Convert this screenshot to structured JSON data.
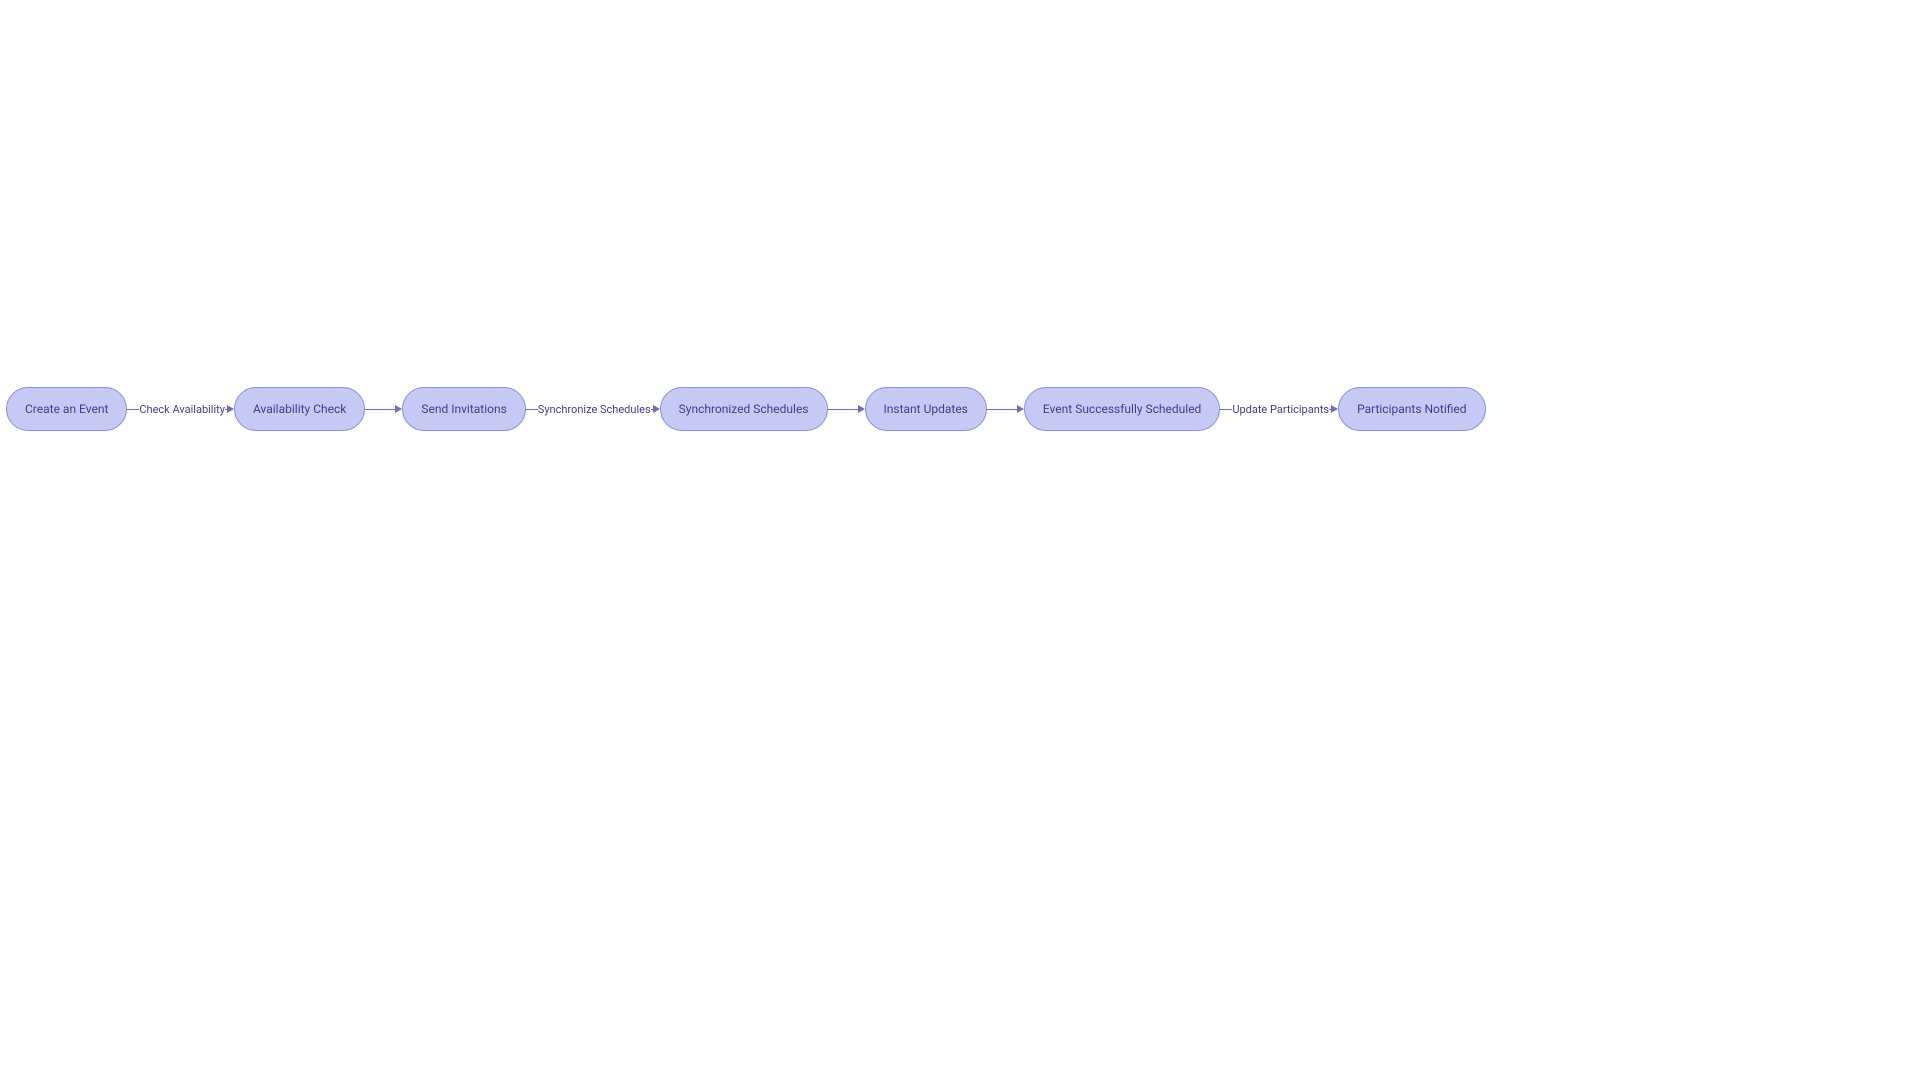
{
  "nodes": [
    {
      "label": "Create an Event"
    },
    {
      "label": "Availability Check"
    },
    {
      "label": "Send Invitations"
    },
    {
      "label": "Synchronized Schedules"
    },
    {
      "label": "Instant Updates"
    },
    {
      "label": "Event Successfully Scheduled"
    },
    {
      "label": "Participants Notified"
    }
  ],
  "edges": [
    {
      "label": "Check Availability"
    },
    {
      "label": ""
    },
    {
      "label": "Synchronize Schedules"
    },
    {
      "label": ""
    },
    {
      "label": ""
    },
    {
      "label": "Update Participants"
    }
  ],
  "colors": {
    "node_fill": "#c7c9f5",
    "node_border": "#8b8ed8",
    "text": "#3d3f8a",
    "line": "#6d6fb8"
  }
}
